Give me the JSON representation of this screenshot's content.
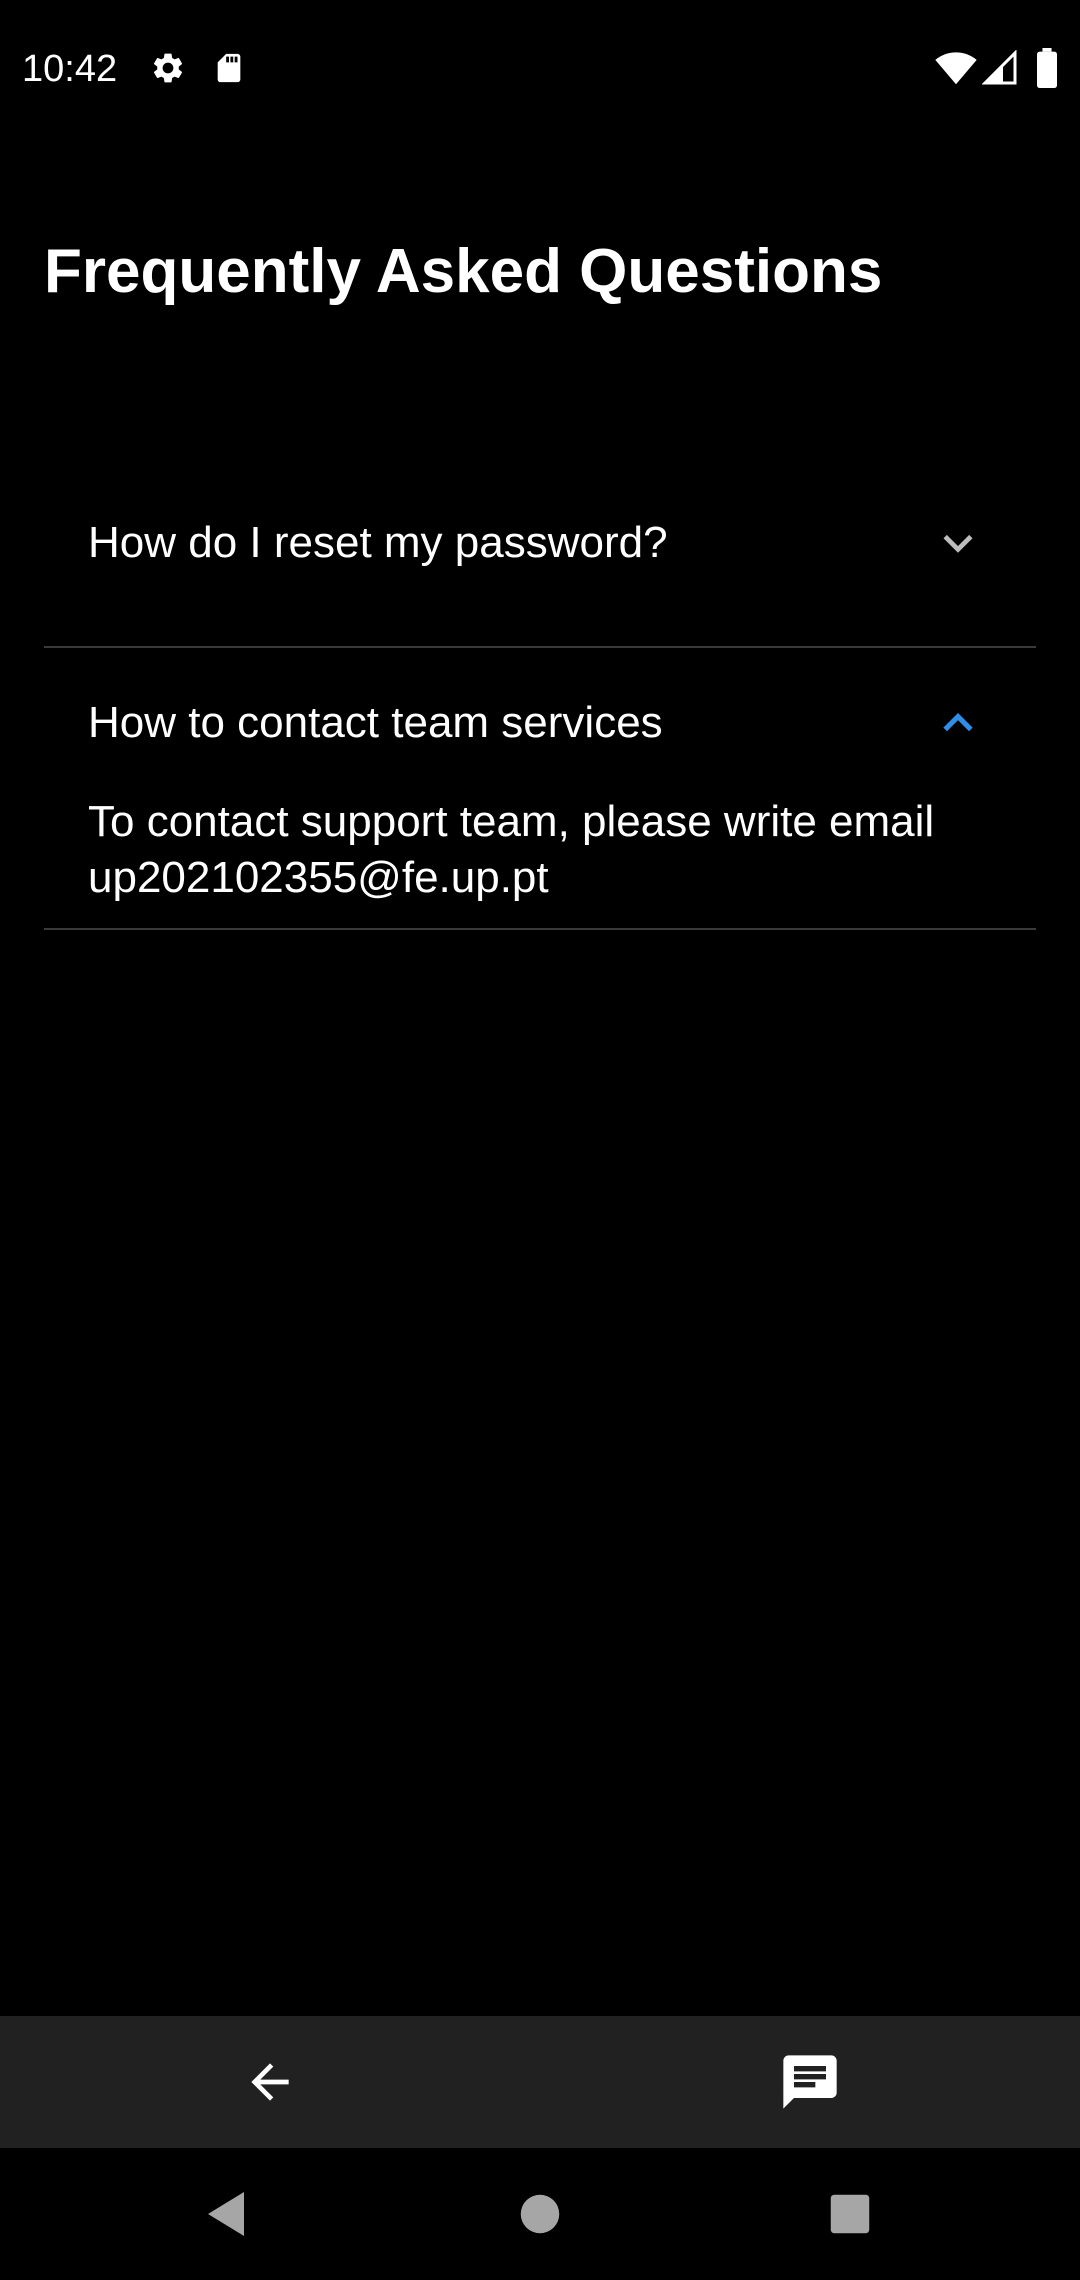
{
  "status_bar": {
    "time": "10:42",
    "icons": [
      "settings-icon",
      "sd-card-icon",
      "wifi-icon",
      "cellular-signal-icon",
      "battery-icon"
    ]
  },
  "page": {
    "title": "Frequently Asked Questions"
  },
  "faq": {
    "items": [
      {
        "question": "How do I reset my password?",
        "expanded": false,
        "chevron": "chevron-down-icon"
      },
      {
        "question": "How to contact team services",
        "expanded": true,
        "chevron": "chevron-up-icon",
        "answer": "To contact support team, please write email up202102355@fe.up.pt"
      }
    ]
  },
  "bottom_bar": {
    "left_icon": "arrow-back-icon",
    "right_icon": "chat-message-icon"
  },
  "system_nav": {
    "icons": [
      "nav-back-icon",
      "nav-home-icon",
      "nav-recents-icon"
    ]
  },
  "colors": {
    "background": "#000000",
    "text": "#ffffff",
    "accent": "#2f8fe8",
    "chevron_collapsed": "#bdbdbd",
    "divider": "#3a3a3a",
    "bottom_bar": "#212121",
    "nav_icons": "#a6a6a6"
  }
}
